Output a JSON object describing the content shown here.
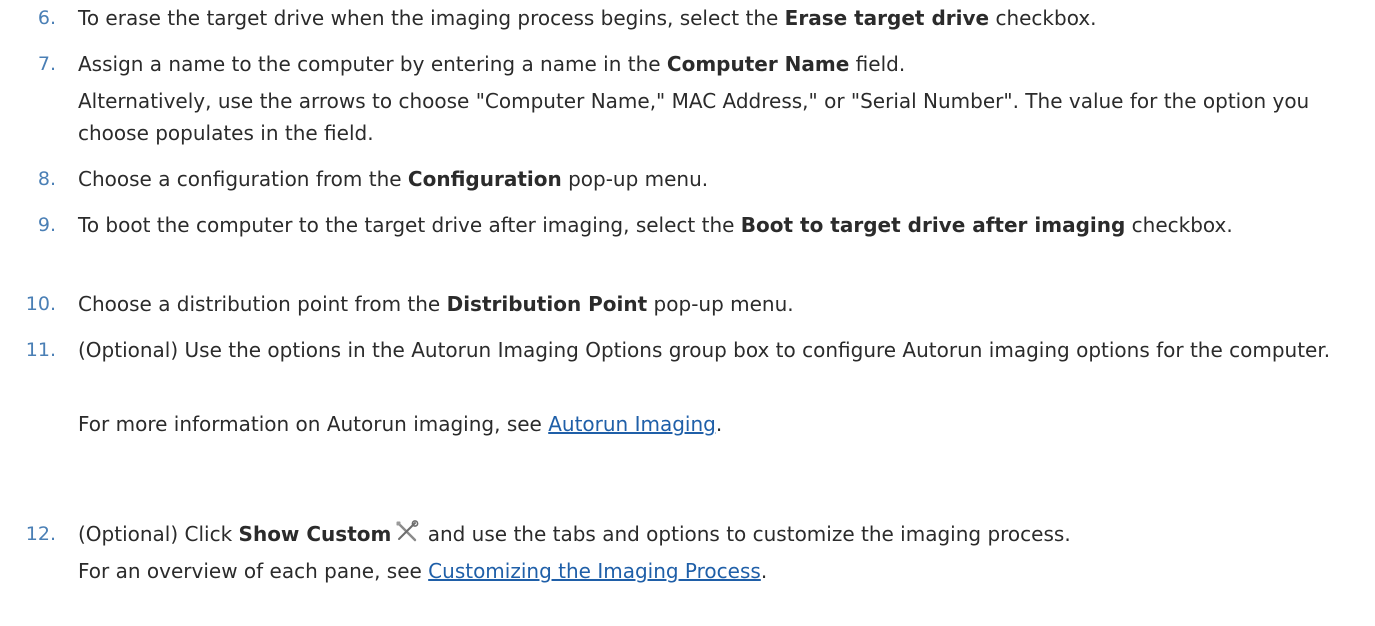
{
  "steps": [
    {
      "number": "6.",
      "before": "To erase the target drive when the imaging process begins, select the ",
      "bold": "Erase target drive",
      "after": " checkbox."
    },
    {
      "number": "7.",
      "before": "Assign a name to the computer by entering a name in the ",
      "bold": "Computer Name",
      "after": " field.",
      "note": "Alternatively, use the arrows to choose \"Computer Name,\" MAC Address,\" or \"Serial Number\". The value for the option you choose populates in the field."
    },
    {
      "number": "8.",
      "before": "Choose a configuration from the ",
      "bold": "Configuration",
      "after": " pop-up menu."
    },
    {
      "number": "9.",
      "before": "To boot the computer to the target drive after imaging, select the ",
      "bold": "Boot to target drive after imaging",
      "after": " checkbox."
    },
    {
      "number": "10.",
      "before": "Choose a distribution point from the ",
      "bold": "Distribution Point",
      "after": " pop-up menu."
    },
    {
      "number": "11.",
      "text": "(Optional) Use the options in the Autorun Imaging Options group box to configure Autorun imaging options for the computer.",
      "note_before": "For more information on Autorun imaging, see ",
      "note_link": "Autorun Imaging",
      "note_after": "."
    },
    {
      "number": "12.",
      "before": "(Optional) Click ",
      "bold": "Show Custom",
      "icon": "wrench-screwdriver-icon",
      "after": " and use the tabs and options to customize the imaging process.",
      "note_before": "For an overview of each pane, see ",
      "note_link": "Customizing the Imaging Process",
      "note_after": "."
    }
  ],
  "colors": {
    "number": "#4a7fb5",
    "text": "#2b2b2b",
    "link": "#1f5fa8"
  }
}
